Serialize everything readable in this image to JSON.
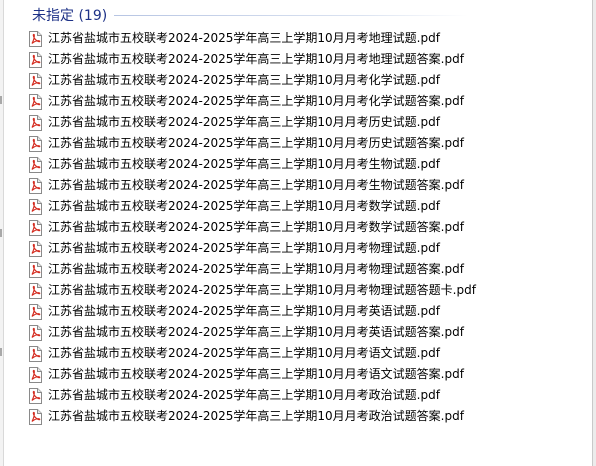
{
  "group": {
    "title": "未指定 (19)"
  },
  "files": [
    {
      "name": "江苏省盐城市五校联考2024-2025学年高三上学期10月月考地理试题.pdf",
      "icon": "pdf-file-icon"
    },
    {
      "name": "江苏省盐城市五校联考2024-2025学年高三上学期10月月考地理试题答案.pdf",
      "icon": "pdf-file-icon"
    },
    {
      "name": "江苏省盐城市五校联考2024-2025学年高三上学期10月月考化学试题.pdf",
      "icon": "pdf-file-icon"
    },
    {
      "name": "江苏省盐城市五校联考2024-2025学年高三上学期10月月考化学试题答案.pdf",
      "icon": "pdf-file-icon"
    },
    {
      "name": "江苏省盐城市五校联考2024-2025学年高三上学期10月月考历史试题.pdf",
      "icon": "pdf-file-icon"
    },
    {
      "name": "江苏省盐城市五校联考2024-2025学年高三上学期10月月考历史试题答案.pdf",
      "icon": "pdf-file-icon"
    },
    {
      "name": "江苏省盐城市五校联考2024-2025学年高三上学期10月月考生物试题.pdf",
      "icon": "pdf-file-icon"
    },
    {
      "name": "江苏省盐城市五校联考2024-2025学年高三上学期10月月考生物试题答案.pdf",
      "icon": "pdf-file-icon"
    },
    {
      "name": "江苏省盐城市五校联考2024-2025学年高三上学期10月月考数学试题.pdf",
      "icon": "pdf-file-icon"
    },
    {
      "name": "江苏省盐城市五校联考2024-2025学年高三上学期10月月考数学试题答案.pdf",
      "icon": "pdf-file-icon"
    },
    {
      "name": "江苏省盐城市五校联考2024-2025学年高三上学期10月月考物理试题.pdf",
      "icon": "pdf-file-icon"
    },
    {
      "name": "江苏省盐城市五校联考2024-2025学年高三上学期10月月考物理试题答案.pdf",
      "icon": "pdf-file-icon"
    },
    {
      "name": "江苏省盐城市五校联考2024-2025学年高三上学期10月月考物理试题答题卡.pdf",
      "icon": "pdf-file-icon"
    },
    {
      "name": "江苏省盐城市五校联考2024-2025学年高三上学期10月月考英语试题.pdf",
      "icon": "pdf-file-icon"
    },
    {
      "name": "江苏省盐城市五校联考2024-2025学年高三上学期10月月考英语试题答案.pdf",
      "icon": "pdf-file-icon"
    },
    {
      "name": "江苏省盐城市五校联考2024-2025学年高三上学期10月月考语文试题.pdf",
      "icon": "pdf-file-icon"
    },
    {
      "name": "江苏省盐城市五校联考2024-2025学年高三上学期10月月考语文试题答案.pdf",
      "icon": "pdf-file-icon"
    },
    {
      "name": "江苏省盐城市五校联考2024-2025学年高三上学期10月月考政治试题.pdf",
      "icon": "pdf-file-icon"
    },
    {
      "name": "江苏省盐城市五校联考2024-2025学年高三上学期10月月考政治试题答案.pdf",
      "icon": "pdf-file-icon"
    }
  ],
  "colors": {
    "group_title": "#1e3287",
    "pdf_icon_red": "#d42a1e",
    "file_text": "#000000"
  }
}
